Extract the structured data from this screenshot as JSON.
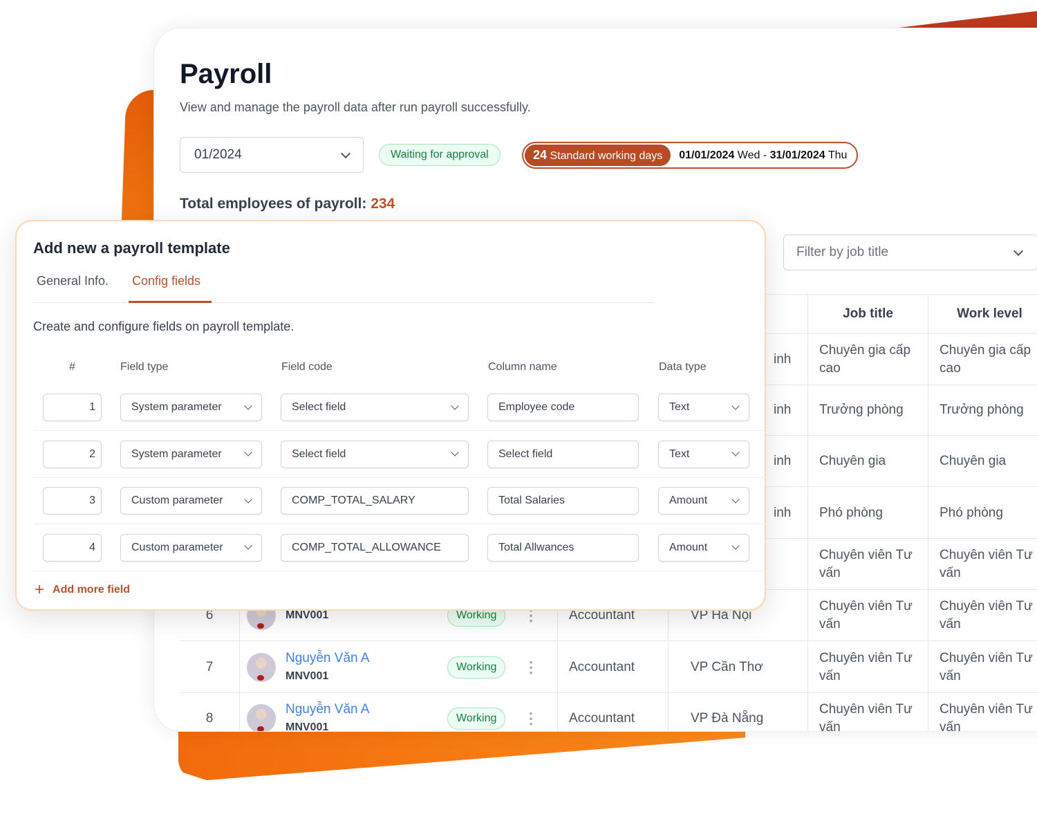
{
  "page": {
    "title": "Payroll",
    "subtitle": "View and manage the payroll data after run payroll successfully.",
    "period": "01/2024",
    "status": "Waiting for approval",
    "working_days": {
      "count": "24",
      "label": "Standard working days",
      "start_date": "01/01/2024",
      "start_day": "Wed",
      "separator": "-",
      "end_date": "31/01/2024",
      "end_day": "Thu"
    },
    "total_label": "Total employees of payroll:",
    "total_value": "234",
    "filter_placeholder": "Filter by job title"
  },
  "table": {
    "headers": {
      "job_title": "Job title",
      "work_level": "Work level"
    },
    "rows": [
      {
        "no": "",
        "name": "",
        "code": "",
        "status": "",
        "position": "",
        "branch": "inh",
        "job_title": "Chuyên gia cấp cao",
        "work_level": "Chuyên gia cấp cao"
      },
      {
        "no": "",
        "name": "",
        "code": "",
        "status": "",
        "position": "",
        "branch": "inh",
        "job_title": "Trưởng phòng",
        "work_level": "Trưởng phòng"
      },
      {
        "no": "",
        "name": "",
        "code": "",
        "status": "",
        "position": "",
        "branch": "inh",
        "job_title": "Chuyên gia",
        "work_level": "Chuyên gia"
      },
      {
        "no": "",
        "name": "",
        "code": "",
        "status": "",
        "position": "",
        "branch": "inh",
        "job_title": "Phó phòng",
        "work_level": "Phó phòng"
      },
      {
        "no": "",
        "name": "",
        "code": "",
        "status": "",
        "position": "",
        "branch": "",
        "job_title": "Chuyên viên Tư vấn",
        "work_level": "Chuyên viên Tư vấn"
      },
      {
        "no": "6",
        "name": "",
        "code": "MNV001",
        "status": "Working",
        "position": "Accountant",
        "branch": "VP Hà Nội",
        "job_title": "Chuyên viên Tư vấn",
        "work_level": "Chuyên viên Tư vấn"
      },
      {
        "no": "7",
        "name": "Nguyễn Văn A",
        "code": "MNV001",
        "status": "Working",
        "position": "Accountant",
        "branch": "VP Cần Thơ",
        "job_title": "Chuyên viên Tư vấn",
        "work_level": "Chuyên viên Tư vấn"
      },
      {
        "no": "8",
        "name": "Nguyễn Văn A",
        "code": "MNV001",
        "status": "Working",
        "position": "Accountant",
        "branch": "VP Đà Nẵng",
        "job_title": "Chuyên viên Tư vấn",
        "work_level": "Chuyên viên Tư vấn"
      }
    ]
  },
  "modal": {
    "title": "Add new a payroll template",
    "tabs": [
      {
        "label": "General Info."
      },
      {
        "label": "Config fields"
      }
    ],
    "description": "Create and configure fields on payroll template.",
    "headers": {
      "no": "#",
      "field_type": "Field type",
      "field_code": "Field code",
      "column_name": "Column name",
      "data_type": "Data type"
    },
    "rows": [
      {
        "no": "1",
        "field_type": "System parameter",
        "field_code": "Select field",
        "field_code_is_select": true,
        "column_name": "Employee code",
        "data_type": "Text"
      },
      {
        "no": "2",
        "field_type": "System parameter",
        "field_code": "Select field",
        "field_code_is_select": true,
        "column_name": "Select field",
        "data_type": "Text"
      },
      {
        "no": "3",
        "field_type": "Custom parameter",
        "field_code": "COMP_TOTAL_SALARY",
        "field_code_is_select": false,
        "column_name": "Total Salaries",
        "data_type": "Amount"
      },
      {
        "no": "4",
        "field_type": "Custom parameter",
        "field_code": "COMP_TOTAL_ALLOWANCE",
        "field_code_is_select": false,
        "column_name": "Total Allwances",
        "data_type": "Amount"
      }
    ],
    "add_more": "Add more field"
  },
  "colors": {
    "accent": "#c0502c",
    "brand_orange": "#f47a10",
    "success": "#15803d",
    "link": "#3b82f6"
  }
}
